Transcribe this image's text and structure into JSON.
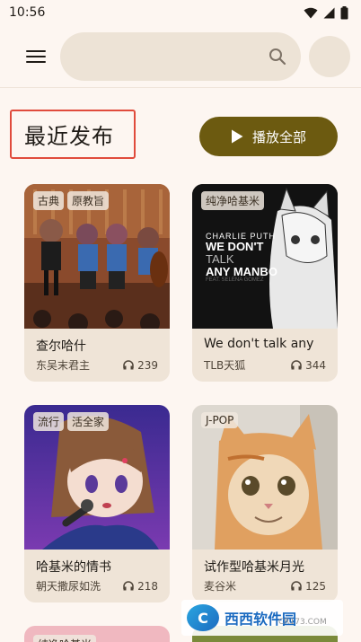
{
  "status": {
    "time": "10:56"
  },
  "search": {
    "placeholder": ""
  },
  "section": {
    "title": "最近发布",
    "play_all": "播放全部"
  },
  "cards": [
    {
      "tags": [
        "古典",
        "原教旨"
      ],
      "title": "查尔哈什",
      "author": "东吴末君主",
      "plays": "239"
    },
    {
      "tags": [
        "纯净哈基米"
      ],
      "title": "We don't talk any",
      "author": "TLB天狐",
      "plays": "344",
      "cover_text": {
        "line1": "CHARLIE PUTH",
        "line2": "WE DON'T",
        "line3": "TALK",
        "line4": "ANY MANBO",
        "line5": "FEAT. SELENA GOMEZ"
      }
    },
    {
      "tags": [
        "流行",
        "活全家"
      ],
      "title": "哈基米的情书",
      "author": "朝天撒尿如洗",
      "plays": "218"
    },
    {
      "tags": [
        "J-POP"
      ],
      "title": "试作型哈基米月光",
      "author": "麦谷米",
      "plays": "125"
    },
    {
      "tags": [
        "纯净哈基米"
      ]
    }
  ],
  "watermark": {
    "text": "西西软件园",
    "sub": "CR173.COM"
  },
  "colors": {
    "background": "#fdf6f1",
    "accent": "#6c5a10",
    "highlight_border": "#e04b3c",
    "card": "#efe4d7"
  }
}
